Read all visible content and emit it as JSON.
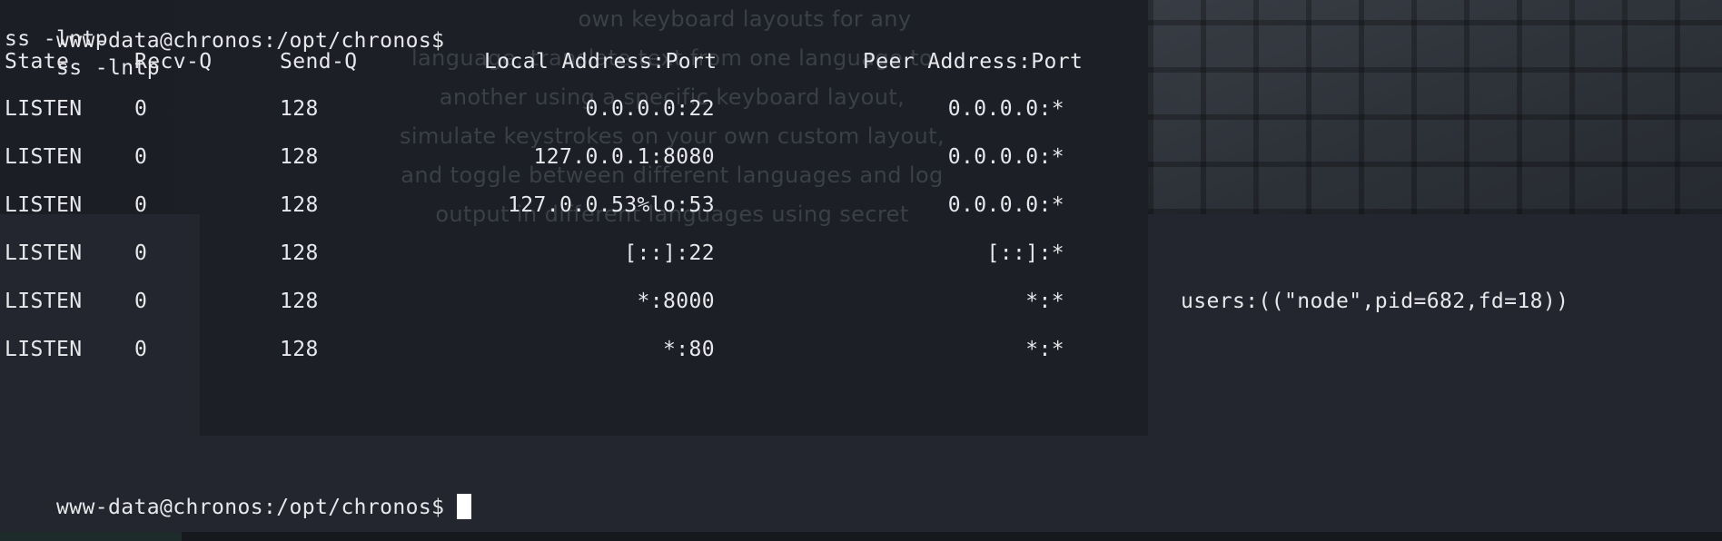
{
  "terminal": {
    "prompt": "www-data@chronos:/opt/chronos$",
    "command": "ss -lntp",
    "echo": "ss -lntp",
    "headers": {
      "state": "State",
      "recvq": "Recv-Q",
      "sendq": "Send-Q",
      "local": "Local Address:Port",
      "peer": "Peer Address:Port"
    },
    "rows": [
      {
        "state": "LISTEN",
        "recvq": "0",
        "sendq": "128",
        "local": "0.0.0.0:22",
        "peer": "0.0.0.0:*",
        "process": ""
      },
      {
        "state": "LISTEN",
        "recvq": "0",
        "sendq": "128",
        "local": "127.0.0.1:8080",
        "peer": "0.0.0.0:*",
        "process": ""
      },
      {
        "state": "LISTEN",
        "recvq": "0",
        "sendq": "128",
        "local": "127.0.0.53%lo:53",
        "peer": "0.0.0.0:*",
        "process": ""
      },
      {
        "state": "LISTEN",
        "recvq": "0",
        "sendq": "128",
        "local": "[::]:22",
        "peer": "[::]:*",
        "process": ""
      },
      {
        "state": "LISTEN",
        "recvq": "0",
        "sendq": "128",
        "local": "*:8000",
        "peer": "*:*",
        "process": "users:((\"node\",pid=682,fd=18))"
      },
      {
        "state": "LISTEN",
        "recvq": "0",
        "sendq": "128",
        "local": "*:80",
        "peer": "*:*",
        "process": ""
      }
    ],
    "final_prompt": "www-data@chronos:/opt/chronos$"
  },
  "wallpaper": {
    "ghost_lines": [
      "own keyboard layouts for any",
      "language, translate text from one language to",
      "another using a specific keyboard layout,",
      "simulate keystrokes on your own custom layout,",
      "and toggle between different languages and log",
      "output in different languages using secret"
    ]
  },
  "colors": {
    "background": "#23262e",
    "text": "#e8e8ec",
    "cursor": "#ffffff"
  }
}
